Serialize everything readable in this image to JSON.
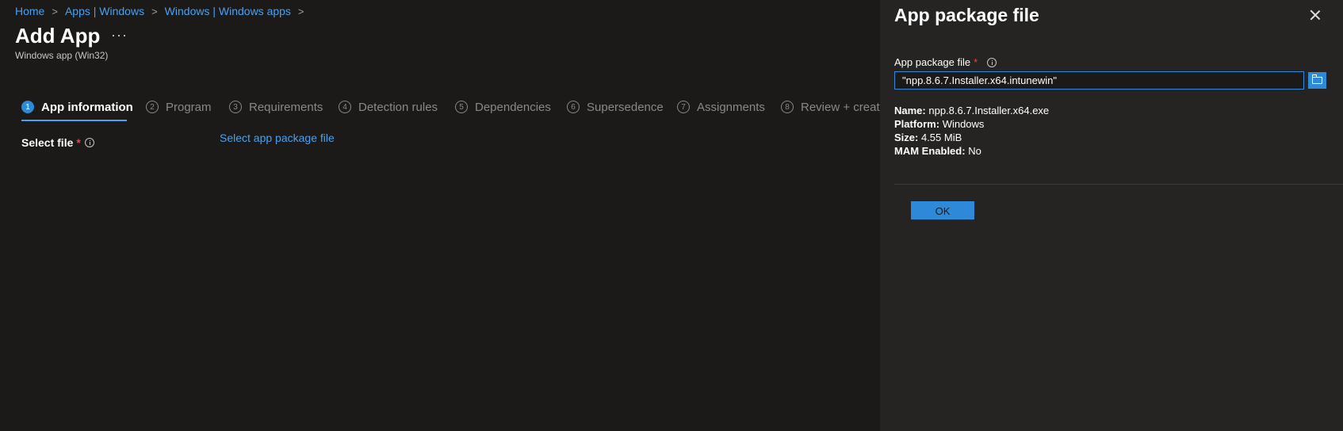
{
  "breadcrumb": [
    {
      "label": "Home"
    },
    {
      "label": "Apps | Windows"
    },
    {
      "label": "Windows | Windows apps"
    }
  ],
  "breadcrumb_separator": ">",
  "page": {
    "title": "Add App",
    "more_label": "···",
    "subtitle": "Windows app (Win32)"
  },
  "steps": [
    {
      "number": "1",
      "label": "App information",
      "active": true
    },
    {
      "number": "2",
      "label": "Program"
    },
    {
      "number": "3",
      "label": "Requirements"
    },
    {
      "number": "4",
      "label": "Detection rules"
    },
    {
      "number": "5",
      "label": "Dependencies"
    },
    {
      "number": "6",
      "label": "Supersedence"
    },
    {
      "number": "7",
      "label": "Assignments"
    },
    {
      "number": "8",
      "label": "Review + create"
    }
  ],
  "form": {
    "select_file_label": "Select file",
    "required_mark": "*",
    "select_link": "Select app package file"
  },
  "panel": {
    "title": "App package file",
    "field_label": "App package file",
    "required_mark": "*",
    "file_value": "\"npp.8.6.7.Installer.x64.intunewin\"",
    "details": [
      {
        "key": "Name:",
        "value": "npp.8.6.7.Installer.x64.exe"
      },
      {
        "key": "Platform:",
        "value": "Windows"
      },
      {
        "key": "Size:",
        "value": "4.55 MiB"
      },
      {
        "key": "MAM Enabled:",
        "value": "No"
      }
    ],
    "ok_label": "OK"
  },
  "colors": {
    "background": "#1b1a19",
    "panel_background": "#252423",
    "accent": "#2e8ad8",
    "link": "#4aa0f0",
    "required": "#e8473c"
  },
  "icons": [
    "chevron-right-icon",
    "more-icon",
    "info-icon",
    "close-icon",
    "folder-icon"
  ]
}
